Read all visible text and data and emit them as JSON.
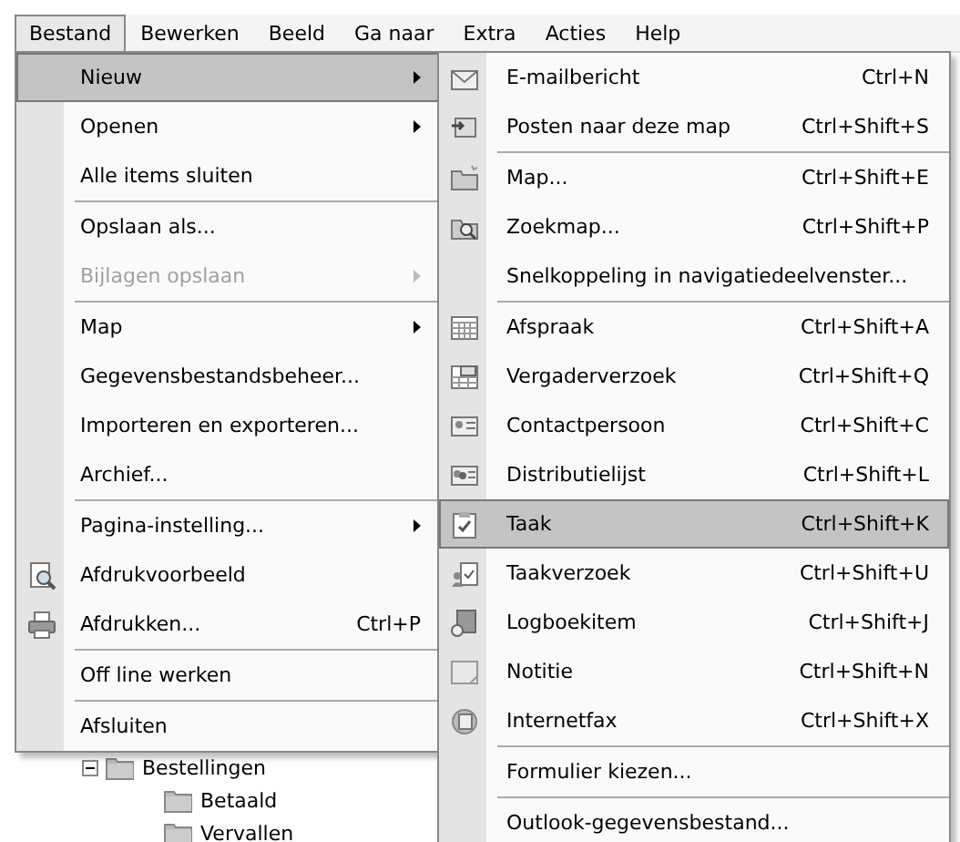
{
  "menu_bar": [
    {
      "label": "Bestand",
      "selected": true
    },
    {
      "label": "Bewerken",
      "selected": false
    },
    {
      "label": "Beeld",
      "selected": false
    },
    {
      "label": "Ga naar",
      "selected": false
    },
    {
      "label": "Extra",
      "selected": false
    },
    {
      "label": "Acties",
      "selected": false
    },
    {
      "label": "Help",
      "selected": false
    }
  ],
  "file_menu": {
    "items": [
      {
        "label": "Nieuw",
        "submenu": true,
        "selected": true,
        "disabled": false
      },
      {
        "label": "Openen",
        "submenu": true,
        "selected": false,
        "disabled": false
      },
      {
        "label": "Alle items sluiten",
        "selected": false,
        "disabled": false
      },
      {
        "label": "Opslaan als...",
        "separator_before": true,
        "selected": false,
        "disabled": false
      },
      {
        "label": "Bijlagen opslaan",
        "submenu": true,
        "selected": false,
        "disabled": true
      },
      {
        "label": "Map",
        "submenu": true,
        "separator_before": true,
        "selected": false,
        "disabled": false
      },
      {
        "label": "Gegevensbestandsbeheer...",
        "selected": false,
        "disabled": false
      },
      {
        "label": "Importeren en exporteren...",
        "selected": false,
        "disabled": false
      },
      {
        "label": "Archief...",
        "selected": false,
        "disabled": false
      },
      {
        "label": "Pagina-instelling...",
        "submenu": true,
        "separator_before": true,
        "selected": false,
        "disabled": false
      },
      {
        "label": "Afdrukvoorbeeld",
        "kind": "preview",
        "selected": false,
        "disabled": false
      },
      {
        "label": "Afdrukken...",
        "kind": "print",
        "shortcut": "Ctrl+P",
        "selected": false,
        "disabled": false
      },
      {
        "label": "Off line werken",
        "separator_before": true,
        "selected": false,
        "disabled": false
      },
      {
        "label": "Afsluiten",
        "separator_before": true,
        "selected": false,
        "disabled": false
      }
    ]
  },
  "new_submenu": {
    "items": [
      {
        "label": "E-mailbericht",
        "kind": "mail",
        "shortcut": "Ctrl+N",
        "selected": false
      },
      {
        "label": "Posten naar deze map",
        "kind": "post",
        "shortcut": "Ctrl+Shift+S",
        "selected": false
      },
      {
        "label": "Map...",
        "kind": "folder",
        "shortcut": "Ctrl+Shift+E",
        "separator_before": true,
        "selected": false
      },
      {
        "label": "Zoekmap...",
        "kind": "search_folder",
        "shortcut": "Ctrl+Shift+P",
        "selected": false
      },
      {
        "label": "Snelkoppeling in navigatiedeelvenster...",
        "selected": false
      },
      {
        "label": "Afspraak",
        "kind": "calendar",
        "shortcut": "Ctrl+Shift+A",
        "separator_before": true,
        "selected": false
      },
      {
        "label": "Vergaderverzoek",
        "kind": "meeting",
        "shortcut": "Ctrl+Shift+Q",
        "selected": false
      },
      {
        "label": "Contactpersoon",
        "kind": "contact",
        "shortcut": "Ctrl+Shift+C",
        "selected": false
      },
      {
        "label": "Distributielijst",
        "kind": "distribution",
        "shortcut": "Ctrl+Shift+L",
        "selected": false
      },
      {
        "label": "Taak",
        "kind": "task",
        "shortcut": "Ctrl+Shift+K",
        "selected": true
      },
      {
        "label": "Taakverzoek",
        "kind": "task_request",
        "shortcut": "Ctrl+Shift+U",
        "selected": false
      },
      {
        "label": "Logboekitem",
        "kind": "journal",
        "shortcut": "Ctrl+Shift+J",
        "selected": false
      },
      {
        "label": "Notitie",
        "kind": "note",
        "shortcut": "Ctrl+Shift+N",
        "selected": false
      },
      {
        "label": "Internetfax",
        "kind": "fax",
        "shortcut": "Ctrl+Shift+X",
        "selected": false
      },
      {
        "label": "Formulier kiezen...",
        "separator_before": true,
        "selected": false
      },
      {
        "label": "Outlook-gegevensbestand...",
        "separator_before": true,
        "selected": false
      }
    ]
  },
  "folder_tree": [
    {
      "label": "Bestellingen",
      "expanded": true,
      "children": [
        {
          "label": "Betaald"
        },
        {
          "label": "Vervallen"
        }
      ]
    }
  ]
}
